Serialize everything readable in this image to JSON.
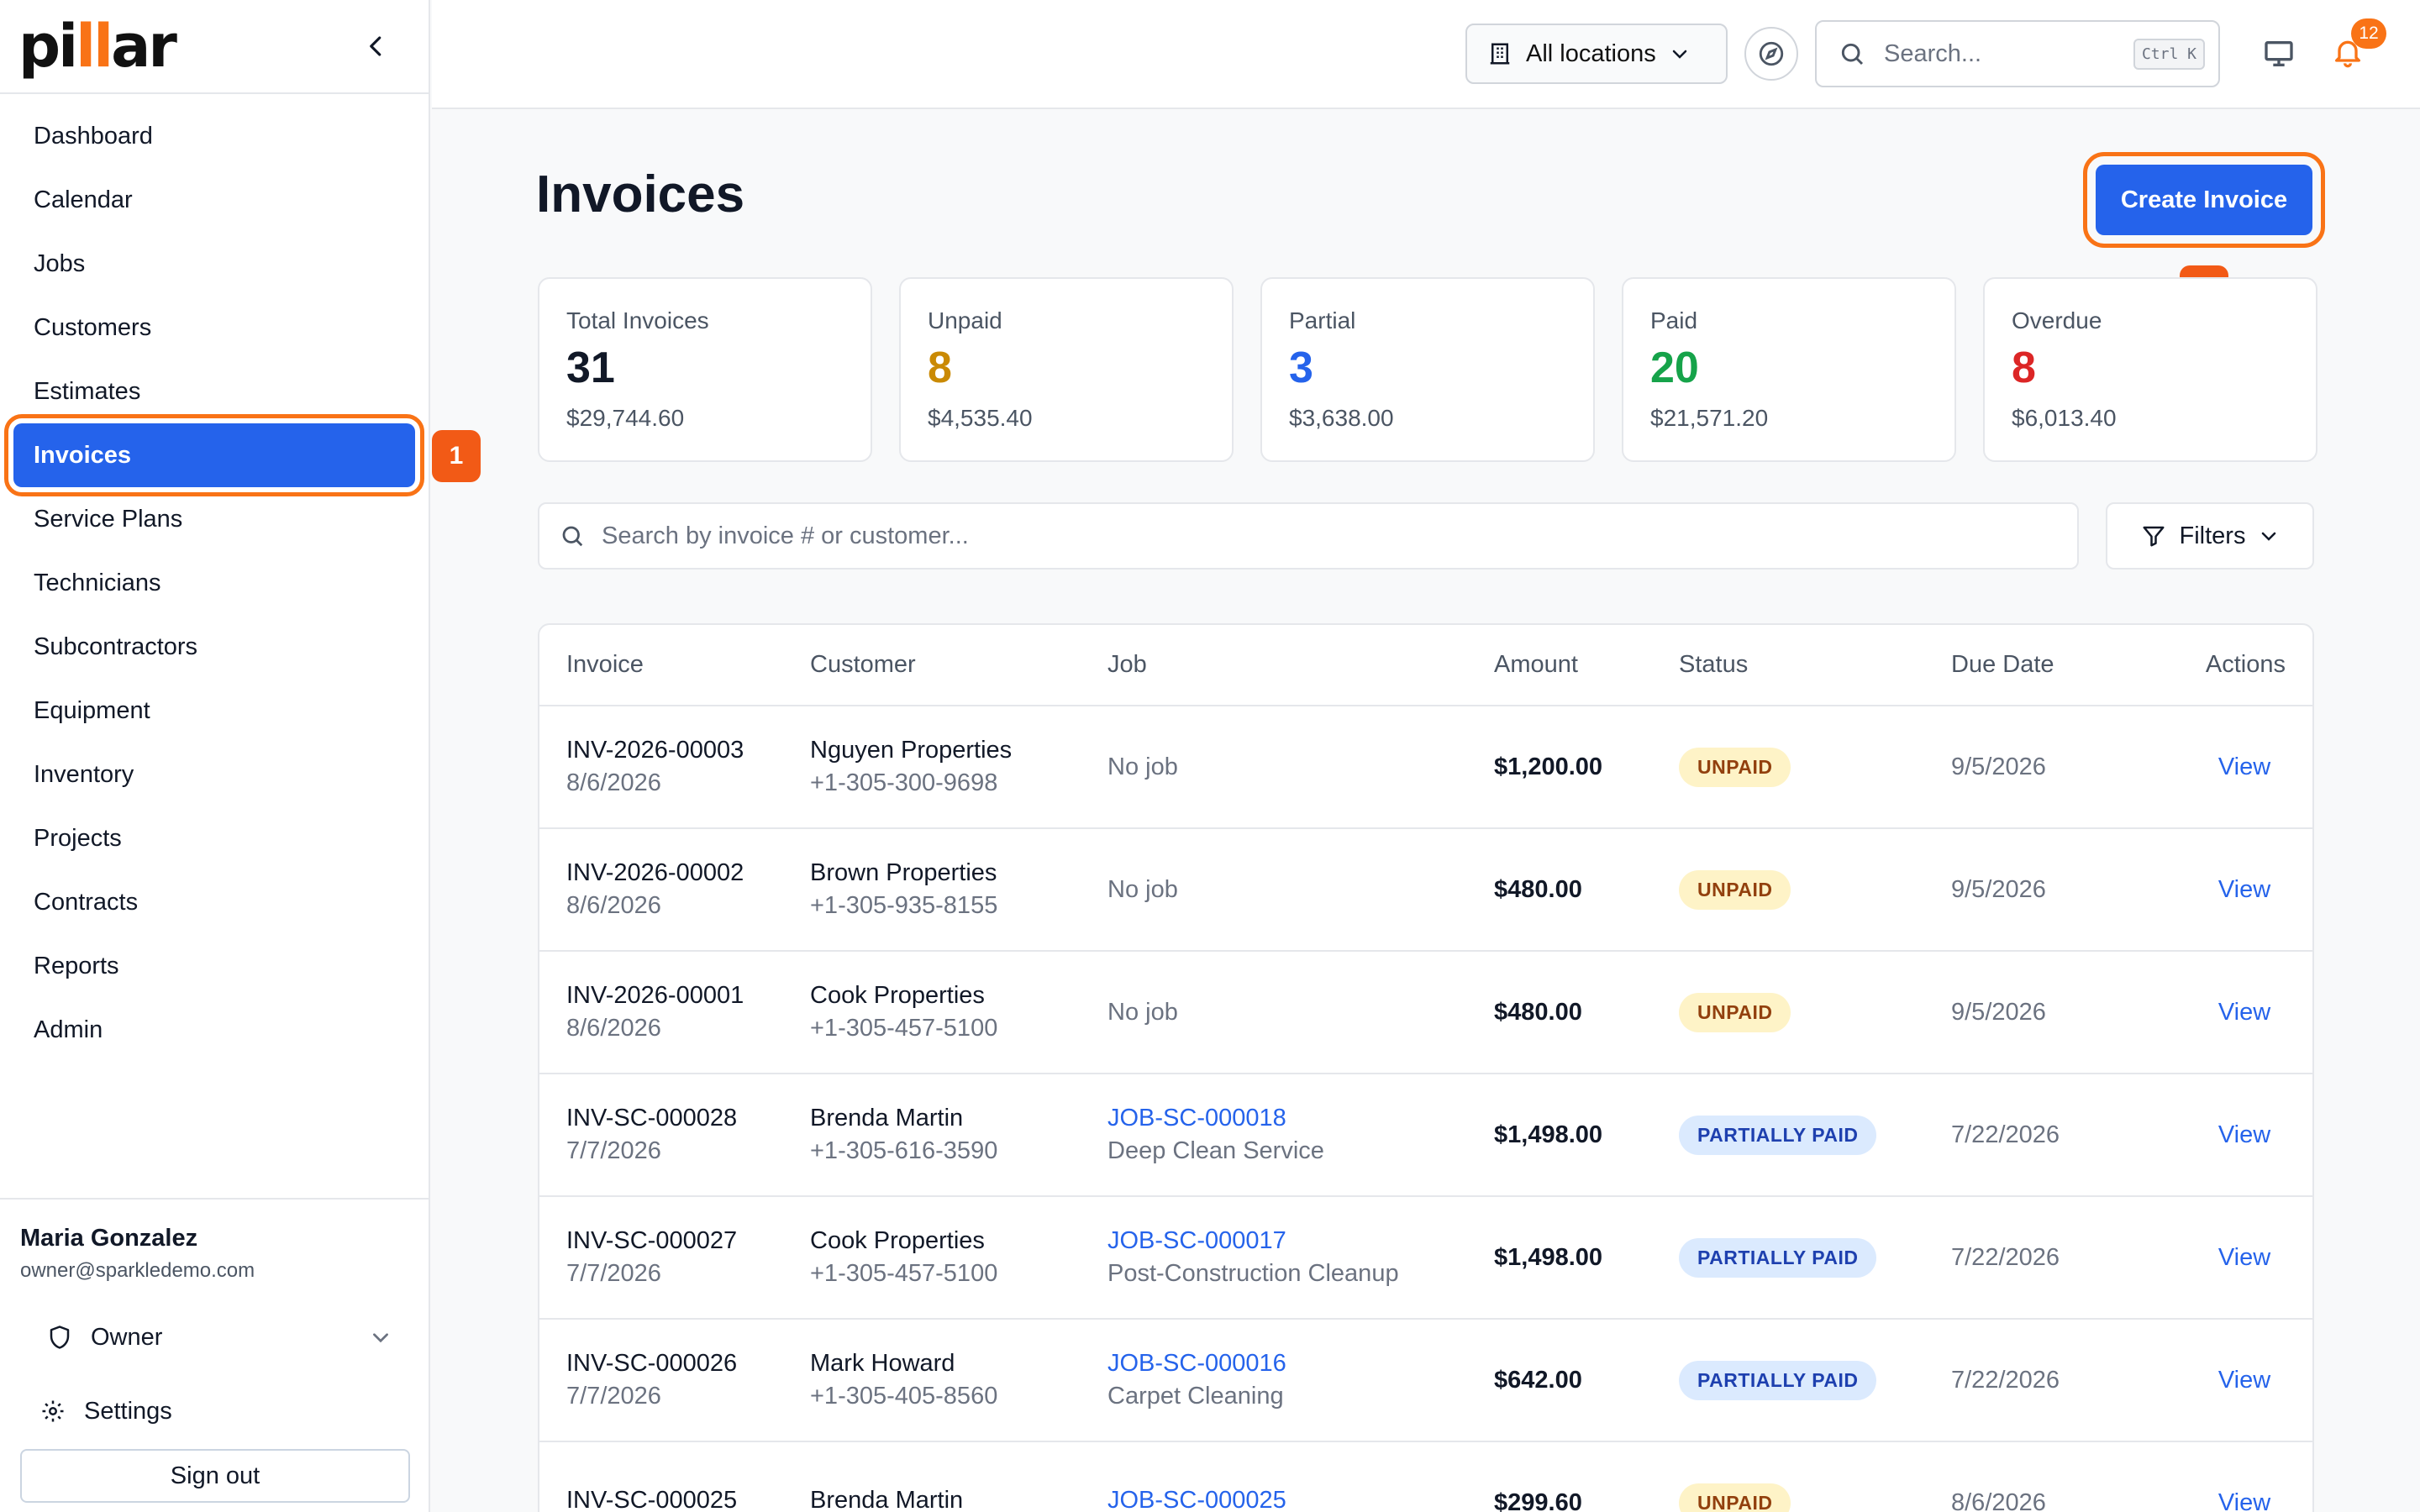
{
  "brand": {
    "logo_prefix": "pi",
    "logo_mid": "ll",
    "logo_suffix": "ar"
  },
  "sidebar": {
    "items": [
      {
        "label": "Dashboard",
        "name": "dashboard"
      },
      {
        "label": "Calendar",
        "name": "calendar"
      },
      {
        "label": "Jobs",
        "name": "jobs"
      },
      {
        "label": "Customers",
        "name": "customers"
      },
      {
        "label": "Estimates",
        "name": "estimates"
      },
      {
        "label": "Invoices",
        "name": "invoices",
        "active": true
      },
      {
        "label": "Service Plans",
        "name": "service-plans"
      },
      {
        "label": "Technicians",
        "name": "technicians"
      },
      {
        "label": "Subcontractors",
        "name": "subcontractors"
      },
      {
        "label": "Equipment",
        "name": "equipment"
      },
      {
        "label": "Inventory",
        "name": "inventory"
      },
      {
        "label": "Projects",
        "name": "projects"
      },
      {
        "label": "Contracts",
        "name": "contracts"
      },
      {
        "label": "Reports",
        "name": "reports"
      },
      {
        "label": "Admin",
        "name": "admin"
      }
    ],
    "user": {
      "name": "Maria Gonzalez",
      "email": "owner@sparkledemo.com",
      "role": "Owner",
      "settings_label": "Settings",
      "signout_label": "Sign out"
    }
  },
  "annotations": {
    "callout_1": "1",
    "callout_2": "2"
  },
  "topbar": {
    "location_label": "All locations",
    "search_placeholder": "Search...",
    "shortcut": "Ctrl K",
    "notification_count": "12"
  },
  "page": {
    "title": "Invoices",
    "create_label": "Create Invoice",
    "search_placeholder": "Search by invoice # or customer...",
    "filters_label": "Filters"
  },
  "stats": [
    {
      "label": "Total Invoices",
      "count": "31",
      "amount": "$29,744.60",
      "color": "#111827"
    },
    {
      "label": "Unpaid",
      "count": "8",
      "amount": "$4,535.40",
      "color": "#ca8a04"
    },
    {
      "label": "Partial",
      "count": "3",
      "amount": "$3,638.00",
      "color": "#2563eb"
    },
    {
      "label": "Paid",
      "count": "20",
      "amount": "$21,571.20",
      "color": "#16a34a"
    },
    {
      "label": "Overdue",
      "count": "8",
      "amount": "$6,013.40",
      "color": "#dc2626"
    }
  ],
  "table": {
    "headers": [
      "Invoice",
      "Customer",
      "Job",
      "Amount",
      "Status",
      "Due Date",
      "Actions"
    ],
    "rows": [
      {
        "invoice": "INV-2026-00003",
        "date": "8/6/2026",
        "customer": "Nguyen Properties",
        "phone": "+1-305-300-9698",
        "job": "No job",
        "job_desc": "",
        "has_job": false,
        "amount": "$1,200.00",
        "status": "UNPAID",
        "status_type": "unpaid",
        "due": "9/5/2026",
        "action": "View"
      },
      {
        "invoice": "INV-2026-00002",
        "date": "8/6/2026",
        "customer": "Brown Properties",
        "phone": "+1-305-935-8155",
        "job": "No job",
        "job_desc": "",
        "has_job": false,
        "amount": "$480.00",
        "status": "UNPAID",
        "status_type": "unpaid",
        "due": "9/5/2026",
        "action": "View"
      },
      {
        "invoice": "INV-2026-00001",
        "date": "8/6/2026",
        "customer": "Cook Properties",
        "phone": "+1-305-457-5100",
        "job": "No job",
        "job_desc": "",
        "has_job": false,
        "amount": "$480.00",
        "status": "UNPAID",
        "status_type": "unpaid",
        "due": "9/5/2026",
        "action": "View"
      },
      {
        "invoice": "INV-SC-000028",
        "date": "7/7/2026",
        "customer": "Brenda Martin",
        "phone": "+1-305-616-3590",
        "job": "JOB-SC-000018",
        "job_desc": "Deep Clean Service",
        "has_job": true,
        "amount": "$1,498.00",
        "status": "PARTIALLY PAID",
        "status_type": "partial",
        "due": "7/22/2026",
        "action": "View"
      },
      {
        "invoice": "INV-SC-000027",
        "date": "7/7/2026",
        "customer": "Cook Properties",
        "phone": "+1-305-457-5100",
        "job": "JOB-SC-000017",
        "job_desc": "Post-Construction Cleanup",
        "has_job": true,
        "amount": "$1,498.00",
        "status": "PARTIALLY PAID",
        "status_type": "partial",
        "due": "7/22/2026",
        "action": "View"
      },
      {
        "invoice": "INV-SC-000026",
        "date": "7/7/2026",
        "customer": "Mark Howard",
        "phone": "+1-305-405-8560",
        "job": "JOB-SC-000016",
        "job_desc": "Carpet Cleaning",
        "has_job": true,
        "amount": "$642.00",
        "status": "PARTIALLY PAID",
        "status_type": "partial",
        "due": "7/22/2026",
        "action": "View"
      },
      {
        "invoice": "INV-SC-000025",
        "date": "",
        "customer": "Brenda Martin",
        "phone": "",
        "job": "JOB-SC-000025",
        "job_desc": "",
        "has_job": true,
        "amount": "$299.60",
        "status": "UNPAID",
        "status_type": "unpaid",
        "due": "8/6/2026",
        "action": "View"
      }
    ]
  },
  "colors": {
    "accent": "#2563eb",
    "highlight": "#f97316"
  }
}
